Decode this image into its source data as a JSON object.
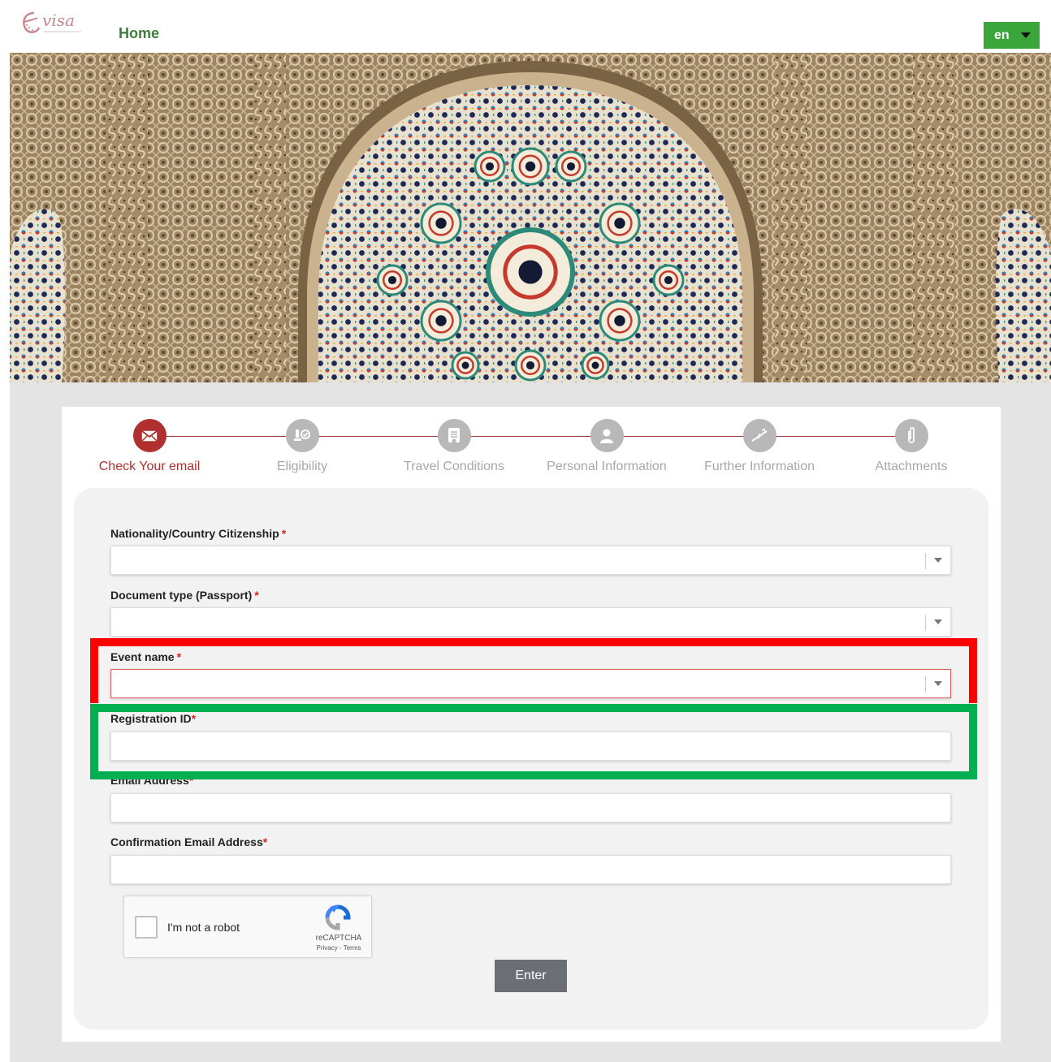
{
  "header": {
    "logo_text": "visa",
    "home_label": "Home",
    "language": "en"
  },
  "stepper": {
    "active_index": 0,
    "steps": [
      {
        "label": "Check Your email",
        "icon": "envelope-icon"
      },
      {
        "label": "Eligibility",
        "icon": "eligibility-icon"
      },
      {
        "label": "Travel Conditions",
        "icon": "document-icon"
      },
      {
        "label": "Personal Information",
        "icon": "person-icon"
      },
      {
        "label": "Further Information",
        "icon": "plane-icon"
      },
      {
        "label": "Attachments",
        "icon": "paperclip-icon"
      }
    ]
  },
  "form": {
    "nationality": {
      "label": "Nationality/Country Citizenship",
      "required": "*",
      "value": ""
    },
    "document_type": {
      "label": "Document type (Passport)",
      "required": "*",
      "value": ""
    },
    "event_name": {
      "label": "Event name",
      "required": "*",
      "value": ""
    },
    "registration_id": {
      "label": "Registration ID",
      "required": "*",
      "value": ""
    },
    "email": {
      "label": "Email Address",
      "required": "*",
      "value": ""
    },
    "confirm_email": {
      "label": "Confirmation Email Address",
      "required": "*",
      "value": ""
    }
  },
  "captcha": {
    "label": "I'm not a robot",
    "brand": "reCAPTCHA",
    "links": "Privacy - Terms"
  },
  "enter_label": "Enter",
  "colors": {
    "brand_green": "#3aa53a",
    "active_step": "#b03030",
    "highlight_red": "#ff0000",
    "highlight_green": "#00b050"
  }
}
